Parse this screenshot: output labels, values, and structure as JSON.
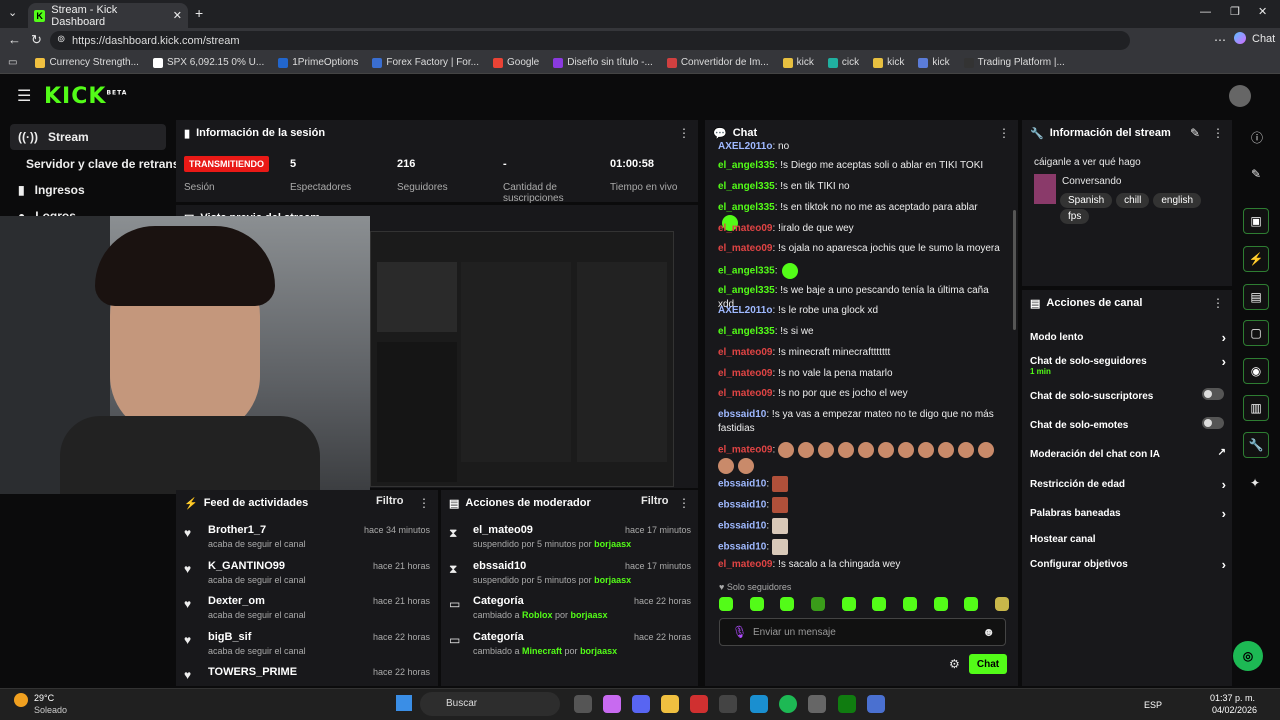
{
  "browser": {
    "tab_title": "Stream - Kick Dashboard",
    "url": "https://dashboard.kick.com/stream",
    "copilot": "Chat",
    "bookmarks": [
      "Currency Strength...",
      "SPX 6,092.15 0% U...",
      "1PrimeOptions",
      "Forex Factory | For...",
      "Google",
      "Diseño sin título -...",
      "Convertidor de Im...",
      "kick",
      "cick",
      "kick",
      "kick",
      "Trading Platform |..."
    ]
  },
  "logo": "KICK",
  "logo_beta": "BETA",
  "sidebar": {
    "items": [
      "Stream",
      "Servidor y clave de retransm",
      "Ingresos",
      "Logros"
    ]
  },
  "session": {
    "title": "Información de la sesión",
    "live_badge": "TRANSMITIENDO",
    "session_label": "Sesión",
    "stats": [
      {
        "value": "5",
        "label": "Espectadores"
      },
      {
        "value": "216",
        "label": "Seguidores"
      },
      {
        "value": "-",
        "label": "Cantidad de suscripciones"
      },
      {
        "value": "01:00:58",
        "label": "Tiempo en vivo"
      }
    ]
  },
  "preview": {
    "title": "Vista previa del stream"
  },
  "feed": {
    "title": "Feed de actividades",
    "filter": "Filtro",
    "items": [
      {
        "name": "Brother1_7",
        "sub": "acaba de seguir el canal",
        "time": "hace 34 minutos"
      },
      {
        "name": "K_GANTINO99",
        "sub": "acaba de seguir el canal",
        "time": "hace 21 horas"
      },
      {
        "name": "Dexter_om",
        "sub": "acaba de seguir el canal",
        "time": "hace 21 horas"
      },
      {
        "name": "bigB_sif",
        "sub": "acaba de seguir el canal",
        "time": "hace 22 horas"
      },
      {
        "name": "TOWERS_PRIME",
        "sub": "",
        "time": "hace 22 horas"
      }
    ]
  },
  "modactions": {
    "title": "Acciones de moderador",
    "filter": "Filtro",
    "items": [
      {
        "name": "el_mateo09",
        "pre": "suspendido por 5 minutos por ",
        "by": "borjaasx",
        "time": "hace 17 minutos"
      },
      {
        "name": "ebssaid10",
        "pre": "suspendido por 5 minutos por ",
        "by": "borjaasx",
        "time": "hace 17 minutos"
      },
      {
        "name": "Categoría",
        "pre": "cambiado a ",
        "mid": "Roblox",
        "post": " por ",
        "by": "borjaasx",
        "time": "hace 22 horas"
      },
      {
        "name": "Categoría",
        "pre": "cambiado a ",
        "mid": "Minecraft",
        "post": " por ",
        "by": "borjaasx",
        "time": "hace 22 horas"
      }
    ]
  },
  "chat": {
    "title": "Chat",
    "top_user": "AXEL2011o",
    "top_msg": ": no",
    "messages": [
      {
        "u": "el_angel335",
        "c": "g",
        "m": ": !s Diego me aceptas soli o ablar en TIKI TOKI"
      },
      {
        "u": "el_angel335",
        "c": "g",
        "m": ": !s en tik TIKI no"
      },
      {
        "u": "el_angel335",
        "c": "g",
        "m": ": !s en tiktok no no me as aceptado para ablar"
      },
      {
        "u": "el_mateo09",
        "c": "r",
        "m": ": !iralo de que wey"
      },
      {
        "u": "el_mateo09",
        "c": "r",
        "m": ": !s ojala no aparesca jochis que le sumo la moyera"
      },
      {
        "u": "el_angel335",
        "c": "g",
        "m": ":"
      },
      {
        "u": "el_angel335",
        "c": "g",
        "m": ": !s we baje a uno pescando tenía la última caña xdd"
      },
      {
        "u": "AXEL2011o",
        "c": "b",
        "m": ": !s le robe una glock xd"
      },
      {
        "u": "el_angel335",
        "c": "g",
        "m": ": !s si we"
      },
      {
        "u": "el_mateo09",
        "c": "r",
        "m": ": !s minecraft minecrafttttttt"
      },
      {
        "u": "el_mateo09",
        "c": "r",
        "m": ": !s no vale la pena matarlo"
      },
      {
        "u": "el_mateo09",
        "c": "r",
        "m": ": !s no por que es jocho el wey"
      },
      {
        "u": "ebssaid10",
        "c": "b",
        "m": ": !s ya vas a empezar mateo no te digo que no más fastidias"
      }
    ],
    "emote_user": "el_mateo09",
    "emote_only": [
      "ebssaid10",
      "ebssaid10",
      "ebssaid10",
      "ebssaid10"
    ],
    "last_user": "el_mateo09",
    "last_msg": ": !s sacalo a la chingada wey",
    "followers_only": "Solo seguidores",
    "input_placeholder": "Enviar un mensaje",
    "send": "Chat"
  },
  "streaminfo": {
    "title": "Información del stream",
    "stream_title": "cáiganle a ver qué hago",
    "category": "Conversando",
    "tags": [
      "Spanish",
      "chill",
      "english",
      "fps"
    ]
  },
  "channel": {
    "title": "Acciones de canal",
    "items": [
      {
        "label": "Modo lento",
        "kind": "chev"
      },
      {
        "label": "Chat de solo-seguidores",
        "sub": "1 min",
        "kind": "chev"
      },
      {
        "label": "Chat de solo-suscriptores",
        "kind": "toggle"
      },
      {
        "label": "Chat de solo-emotes",
        "kind": "toggle"
      },
      {
        "label": "Moderación del chat con IA",
        "kind": "ext"
      },
      {
        "label": "Restricción de edad",
        "kind": "chev"
      },
      {
        "label": "Palabras baneadas",
        "kind": "chev"
      },
      {
        "label": "Hostear canal",
        "kind": "none"
      },
      {
        "label": "Configurar objetivos",
        "kind": "chev"
      }
    ]
  },
  "taskbar": {
    "temp": "29°C",
    "weather": "Soleado",
    "search": "Buscar",
    "lang": "ESP",
    "time": "01:37 p. m.",
    "date": "04/02/2026"
  },
  "colors": {
    "kick_green": "#53fc18",
    "live_red": "#e91916",
    "panel": "#18181b"
  }
}
